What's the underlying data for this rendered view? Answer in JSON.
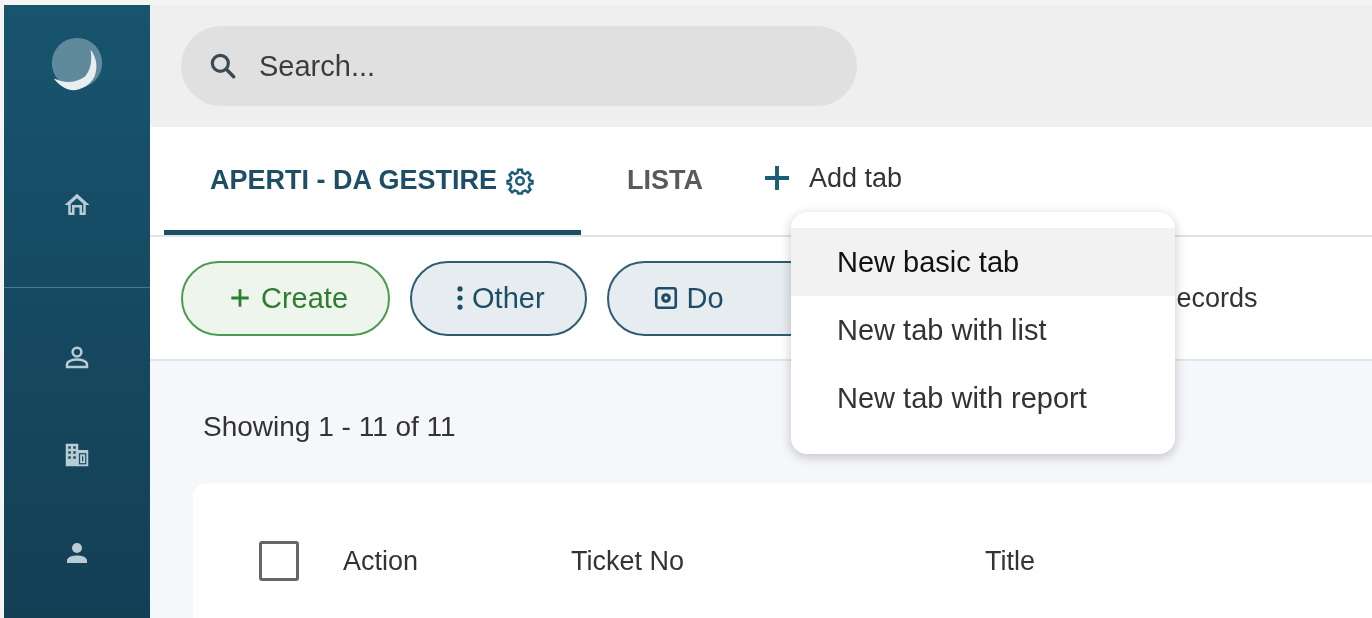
{
  "sidebar": {
    "items": [
      {
        "kind": "home",
        "selected": false
      },
      {
        "kind": "contact",
        "selected": false
      },
      {
        "kind": "company",
        "selected": false
      },
      {
        "kind": "user",
        "selected": false
      }
    ]
  },
  "search": {
    "placeholder": "Search..."
  },
  "tabs": [
    {
      "label": "APERTI - DA GESTIRE",
      "selected": true,
      "settings": true
    },
    {
      "label": "LISTA",
      "selected": false,
      "settings": false
    }
  ],
  "add_tab": {
    "label": "Add tab"
  },
  "toolbar": {
    "buttons": [
      {
        "kind": "create",
        "label": "Create"
      },
      {
        "kind": "other",
        "label": "Other"
      },
      {
        "kind": "document",
        "label": "Do"
      }
    ],
    "records_text": "ecords"
  },
  "dropdown": {
    "items": [
      {
        "label": "New basic tab",
        "selected": true
      },
      {
        "label": "New tab with list",
        "selected": false
      },
      {
        "label": "New tab with report",
        "selected": false
      }
    ]
  },
  "summary": "Showing 1 - 11 of 11",
  "table": {
    "select_all": {
      "checked": false
    },
    "columns": [
      "Action",
      "Ticket No",
      "Title"
    ]
  }
}
